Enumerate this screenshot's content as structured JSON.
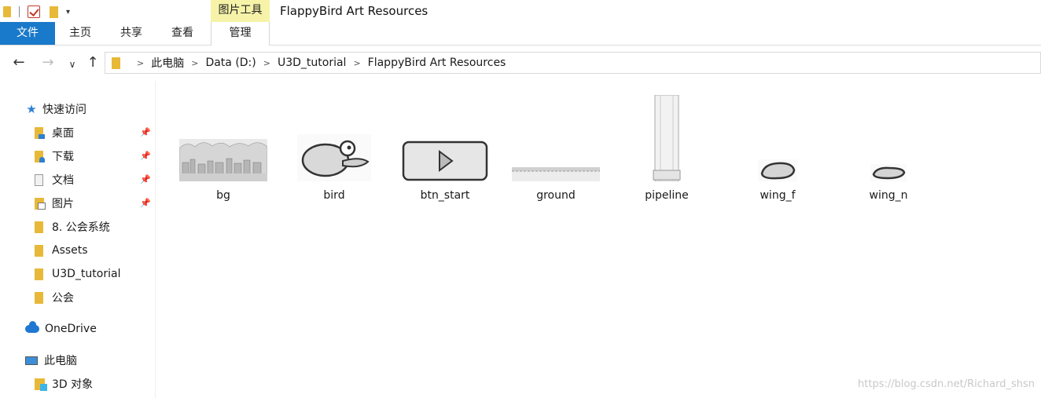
{
  "window": {
    "title": "FlappyBird Art Resources"
  },
  "ribbon": {
    "contextual_tab": "图片工具",
    "tabs": {
      "file": "文件",
      "home": "主页",
      "share": "共享",
      "view": "查看",
      "manage": "管理"
    }
  },
  "nav": {
    "back_glyph": "←",
    "forward_glyph": "→",
    "recent_glyph": "∨",
    "up_glyph": "↑",
    "breadcrumbs": [
      "此电脑",
      "Data (D:)",
      "U3D_tutorial",
      "FlappyBird Art Resources"
    ],
    "sep_glyph": ">"
  },
  "sidebar": {
    "quick_access": "快速访问",
    "items": [
      {
        "label": "桌面",
        "pinned": true
      },
      {
        "label": "下载",
        "pinned": true
      },
      {
        "label": "文档",
        "pinned": true
      },
      {
        "label": "图片",
        "pinned": true
      },
      {
        "label": "8. 公会系统",
        "pinned": false
      },
      {
        "label": "Assets",
        "pinned": false
      },
      {
        "label": "U3D_tutorial",
        "pinned": false
      },
      {
        "label": "公会",
        "pinned": false
      }
    ],
    "onedrive": "OneDrive",
    "this_pc": "此电脑",
    "objects_3d": "3D 对象",
    "pin_glyph": "📌"
  },
  "files": [
    {
      "name": "bg",
      "thumb": "bg-thumbnail"
    },
    {
      "name": "bird",
      "thumb": "bird-thumbnail"
    },
    {
      "name": "btn_start",
      "thumb": "btn-start-thumbnail"
    },
    {
      "name": "ground",
      "thumb": "ground-thumbnail"
    },
    {
      "name": "pipeline",
      "thumb": "pipeline-thumbnail"
    },
    {
      "name": "wing_f",
      "thumb": "wing-f-thumbnail"
    },
    {
      "name": "wing_n",
      "thumb": "wing-n-thumbnail"
    }
  ],
  "watermark": "https://blog.csdn.net/Richard_shsn",
  "colors": {
    "file_tab": "#1979ca",
    "contextual_tab": "#f6f3a8",
    "folder": "#e8b938",
    "accent_blue": "#2f7fd1"
  }
}
